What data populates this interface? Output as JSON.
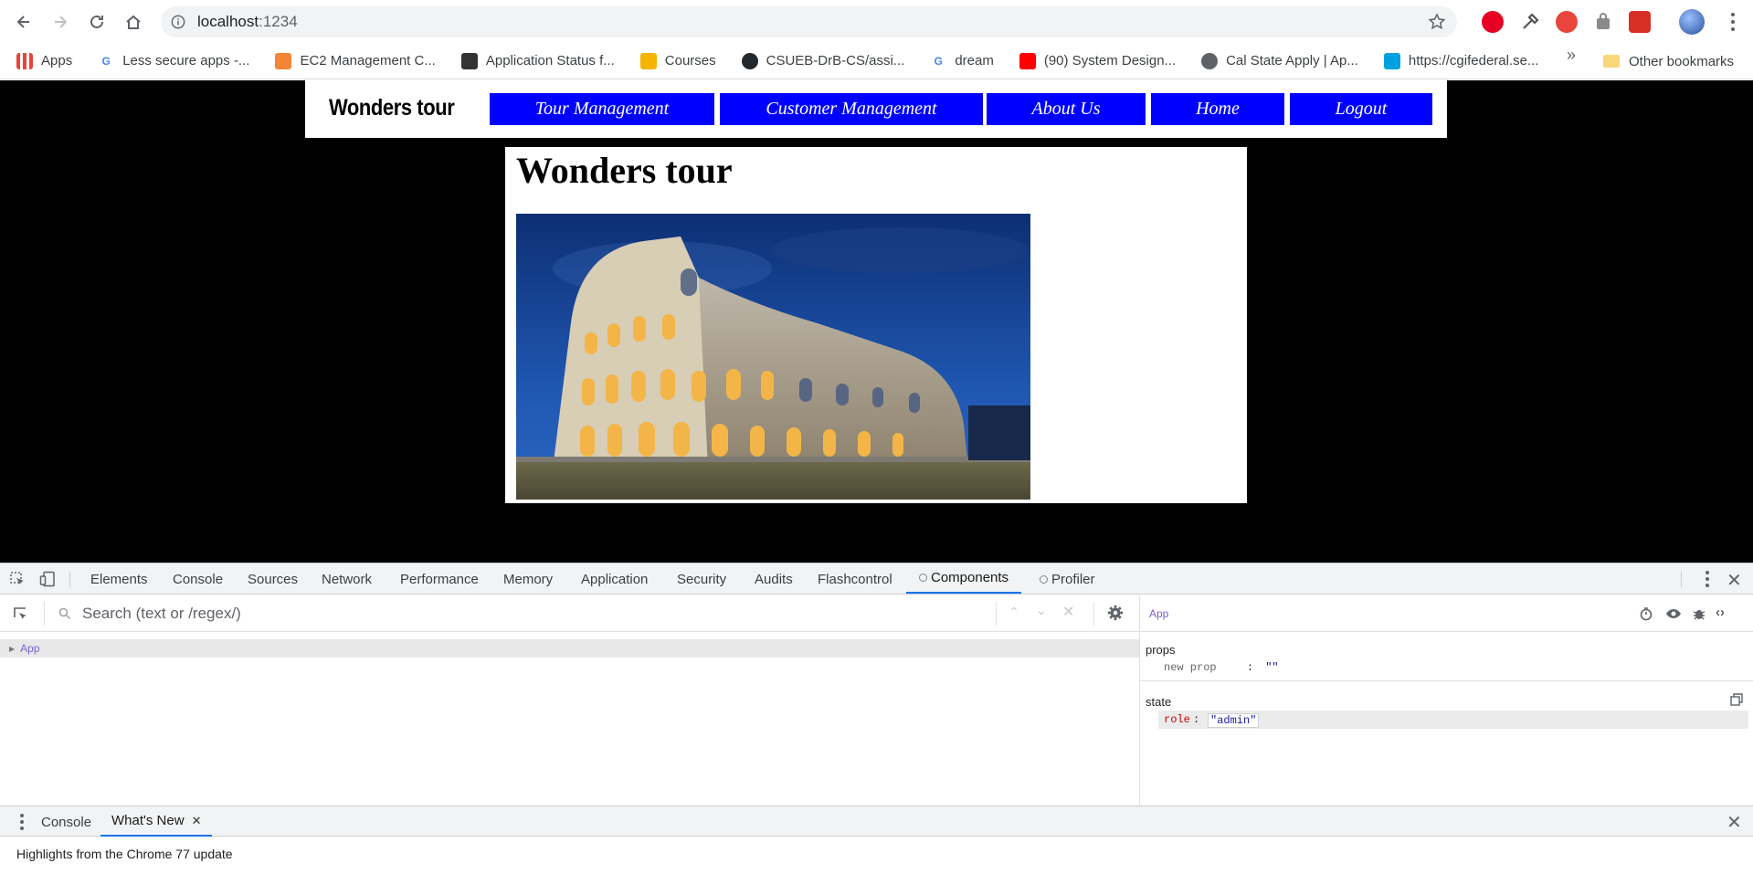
{
  "browser": {
    "url_host": "localhost",
    "url_port": ":1234"
  },
  "bookmarks": [
    {
      "label": "Apps",
      "icon": "apps-grid-icon",
      "color": "#4285f4"
    },
    {
      "label": "Less secure apps -...",
      "icon": "google-icon",
      "color": "#4285f4"
    },
    {
      "label": "EC2 Management C...",
      "icon": "aws-cube-icon",
      "color": "#f58536"
    },
    {
      "label": "Application Status f...",
      "icon": "people-icon",
      "color": "#333333"
    },
    {
      "label": "Courses",
      "icon": "pencil-icon",
      "color": "#f4b400"
    },
    {
      "label": "CSUEB-DrB-CS/assi...",
      "icon": "github-icon",
      "color": "#24292e"
    },
    {
      "label": "dream",
      "icon": "google-icon",
      "color": "#4285f4"
    },
    {
      "label": "(90) System Design...",
      "icon": "youtube-icon",
      "color": "#ff0000"
    },
    {
      "label": "Cal State Apply | Ap...",
      "icon": "globe-icon",
      "color": "#5f6368"
    },
    {
      "label": "https://cgifederal.se...",
      "icon": "salesforce-cloud-icon",
      "color": "#00a1e0"
    }
  ],
  "bookmarks_more": "»",
  "other_bookmarks": "Other bookmarks",
  "site": {
    "brand": "Wonders tour",
    "nav": [
      "Tour Management",
      "Customer Management",
      "About Us",
      "Home",
      "Logout"
    ],
    "title": "Wonders tour",
    "accent": "#0000ff"
  },
  "devtools": {
    "tabs": [
      "Elements",
      "Console",
      "Sources",
      "Network",
      "Performance",
      "Memory",
      "Application",
      "Security",
      "Audits",
      "Flashcontrol",
      "Components",
      "Profiler"
    ],
    "active_tab": "Components",
    "search_placeholder": "Search (text or /regex/)",
    "tree_root": "App",
    "selected_component": "App",
    "props_label": "props",
    "prop_key": "new prop",
    "prop_colon": ":",
    "prop_value": "\"\"",
    "state_label": "state",
    "state_key": "role",
    "state_colon": ":",
    "state_value": "\"admin\"",
    "drawer_tabs": [
      "Console",
      "What's New"
    ],
    "drawer_active": "What's New",
    "drawer_text": "Highlights from the Chrome 77 update"
  }
}
